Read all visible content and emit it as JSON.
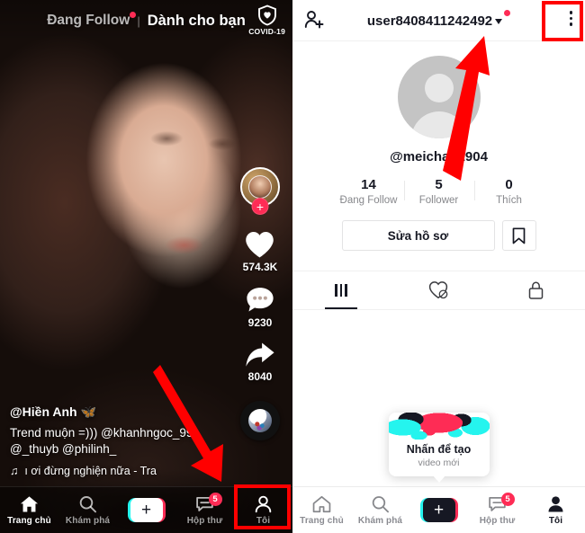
{
  "feed": {
    "tab_following": "Đang Follow",
    "tab_separator": "|",
    "tab_foryou": "Dành cho bạn",
    "covid_label": "COVID-19",
    "actions": {
      "like_count": "574.3K",
      "comment_count": "9230",
      "share_count": "8040",
      "follow_plus": "+"
    },
    "caption": {
      "username": "@Hiền Anh 🦋",
      "text": "Trend muộn =))) @khanhngoc_99_ @_thuyb @philinh_",
      "music": "ı ơi đừng nghiện nữa - Tra",
      "music_note": "♫"
    },
    "nav": {
      "home": "Trang chủ",
      "discover": "Khám phá",
      "create": "+",
      "inbox": "Hộp thư",
      "inbox_badge": "5",
      "me": "Tôi"
    }
  },
  "profile": {
    "header": {
      "title": "user8408411242492",
      "add_friend_icon": "add-person-icon",
      "more_icon": "three-dot-menu-icon"
    },
    "handle": "@meichan1904",
    "stats": [
      {
        "value": "14",
        "label": "Đang Follow"
      },
      {
        "value": "5",
        "label": "Follower"
      },
      {
        "value": "0",
        "label": "Thích"
      }
    ],
    "edit_button": "Sửa hồ sơ",
    "bookmark_icon": "bookmark-icon",
    "tabs": [
      {
        "icon": "grid-icon",
        "active": true
      },
      {
        "icon": "heart-slash-icon",
        "active": false
      },
      {
        "icon": "lock-icon",
        "active": false
      }
    ],
    "tooltip": {
      "title": "Nhấn để tạo",
      "subtitle": "video mới"
    },
    "nav": {
      "home": "Trang chủ",
      "discover": "Khám phá",
      "create": "+",
      "inbox": "Hộp thư",
      "inbox_badge": "5",
      "me": "Tôi"
    }
  },
  "annotations": {
    "highlight_color": "#ff0000",
    "arrow_left_target": "me-tab-left",
    "arrow_right_target": "three-dot-menu"
  }
}
